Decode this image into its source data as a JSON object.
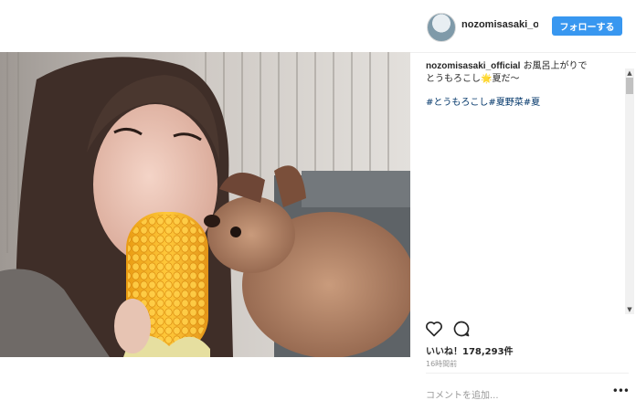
{
  "post": {
    "username": "nozomisasaki_official",
    "follow_label": "フォローする",
    "caption_user": "nozomisasaki_official",
    "caption_line1": "お風呂上がりで",
    "caption_line2": "とうもろこし🌟夏だ〜",
    "hashtags": [
      "#とうもろこし",
      "#夏野菜",
      "#夏"
    ],
    "likes_label": "いいね！178,293件",
    "time_ago": "16時間前",
    "comment_placeholder": "コメントを追加...",
    "more_label": "•••"
  },
  "icons": {
    "like": "heart-outline-icon",
    "comment": "comment-bubble-icon",
    "more": "more-dots-icon"
  },
  "colors": {
    "follow_button": "#3897f0",
    "hashtag": "#003569",
    "muted_text": "#999999"
  }
}
